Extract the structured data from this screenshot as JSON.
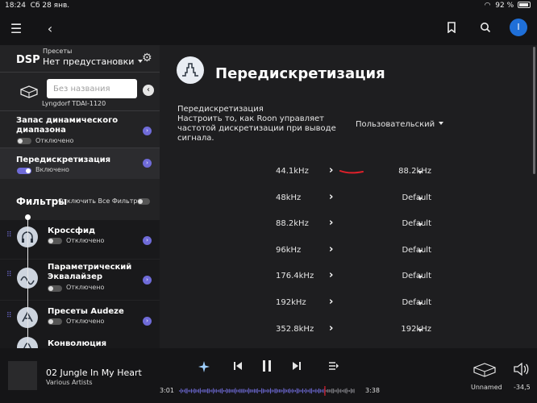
{
  "status": {
    "time": "18:24",
    "date": "Сб 28 янв.",
    "battery": "92 %"
  },
  "topbar": {
    "avatar_letter": "I"
  },
  "dsp": {
    "title": "DSP",
    "presets_label": "Пресеты",
    "preset_value": "Нет предустановки",
    "name_placeholder": "Без названия",
    "device_name": "Lyngdorf TDAI-1120",
    "headroom_title": "Запас динамического диапазона",
    "headroom_status": "Отключено",
    "resample_title": "Передискретизация",
    "resample_status": "Включено",
    "filters_title": "Фильтры",
    "filters_disable_all": "Отключить Все Фильтры",
    "filters": [
      {
        "title": "Кроссфид",
        "status": "Отключено",
        "icon": "headphones-icon"
      },
      {
        "title": "Параметрический Эквалайзер",
        "status": "Отключено",
        "icon": "eq-curve-icon"
      },
      {
        "title": "Пресеты Audeze",
        "status": "Отключено",
        "icon": "audeze-icon"
      },
      {
        "title": "Конволюция",
        "status": "",
        "icon": "convolution-icon"
      }
    ]
  },
  "main": {
    "title": "Передискретизация",
    "desc_title": "Передискретизация",
    "desc_text": "Настроить то, как Roon управляет частотой дискретизации при выводе сигнала.",
    "mode": "Пользовательский",
    "rates": [
      {
        "src": "44.1kHz",
        "dst": "88.2kHz"
      },
      {
        "src": "48kHz",
        "dst": "Default"
      },
      {
        "src": "88.2kHz",
        "dst": "Default"
      },
      {
        "src": "96kHz",
        "dst": "Default"
      },
      {
        "src": "176.4kHz",
        "dst": "Default"
      },
      {
        "src": "192kHz",
        "dst": "Default"
      },
      {
        "src": "352.8kHz",
        "dst": "192kHz"
      }
    ]
  },
  "player": {
    "track": "02 Jungle In My Heart",
    "artist": "Various Artists",
    "elapsed": "3:01",
    "duration": "3:38",
    "progress": 0.83,
    "zone": "Unnamed",
    "volume": "-34,5"
  },
  "colors": {
    "accent": "#6f6bd8",
    "avatar": "#1f6fd8",
    "annotation": "#e0202a"
  }
}
